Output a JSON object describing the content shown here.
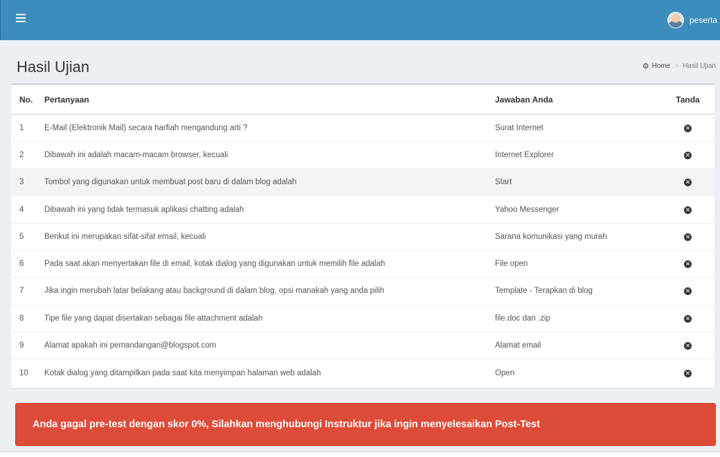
{
  "header": {
    "user_name": "peserta"
  },
  "page": {
    "title": "Hasil Ujian",
    "breadcrumb": {
      "home": "Home",
      "current": "Hasil Ujian"
    }
  },
  "table": {
    "headers": {
      "no": "No.",
      "question": "Pertanyaan",
      "answer": "Jawaban Anda",
      "mark": "Tanda"
    },
    "rows": [
      {
        "no": "1",
        "question": "E-Mail (Elektronik Mail) secara harfiah mengandung arti ?",
        "answer": "Surat Internet",
        "mark": "✕"
      },
      {
        "no": "2",
        "question": "Dibawah ini adalah macam-macam browser, kecuali",
        "answer": "Internet Explorer",
        "mark": "✕"
      },
      {
        "no": "3",
        "question": "Tombol yang digunakan untuk membuat post baru di dalam blog adalah",
        "answer": "Start",
        "mark": "✕"
      },
      {
        "no": "4",
        "question": "Dibawah ini yang tidak termasuk aplikasi chatting adalah",
        "answer": "Yahoo Messenger",
        "mark": "✕"
      },
      {
        "no": "5",
        "question": "Berikut ini merupakan sifat-sifat email, kecuali",
        "answer": "Sarana komunikasi yang murah",
        "mark": "✕"
      },
      {
        "no": "6",
        "question": "Pada saat akan menyertakan file di email, kotak dialog yang digunakan untuk memilih file adalah",
        "answer": "File open",
        "mark": "✕"
      },
      {
        "no": "7",
        "question": "Jika ingin merubah latar belakang atau background di dalam blog, opsi manakah yang anda pilih",
        "answer": "Template - Terapkan di blog",
        "mark": "✕"
      },
      {
        "no": "8",
        "question": "Tipe file yang dapat disertakan sebagai file attachment adalah",
        "answer": "file.doc dan .zip",
        "mark": "✕"
      },
      {
        "no": "9",
        "question": "Alamat apakah ini pemandangan@blogspot.com",
        "answer": "Alamat email",
        "mark": "✕"
      },
      {
        "no": "10",
        "question": "Kotak dialog yang ditampilkan pada saat kita menyimpan halaman web adalah",
        "answer": "Open",
        "mark": "✕"
      }
    ]
  },
  "alert": {
    "message": "Anda gagal pre-test dengan skor 0%, Silahkan menghubungi Instruktur jika ingin menyelesaikan Post-Test"
  },
  "icons": {
    "menu": "hamburger-icon",
    "home": "dashboard-icon",
    "mark": "times-circle-icon"
  },
  "colors": {
    "topbar": "#3c8dbc",
    "alert": "#dd4b39",
    "background": "#ecf0f5"
  }
}
